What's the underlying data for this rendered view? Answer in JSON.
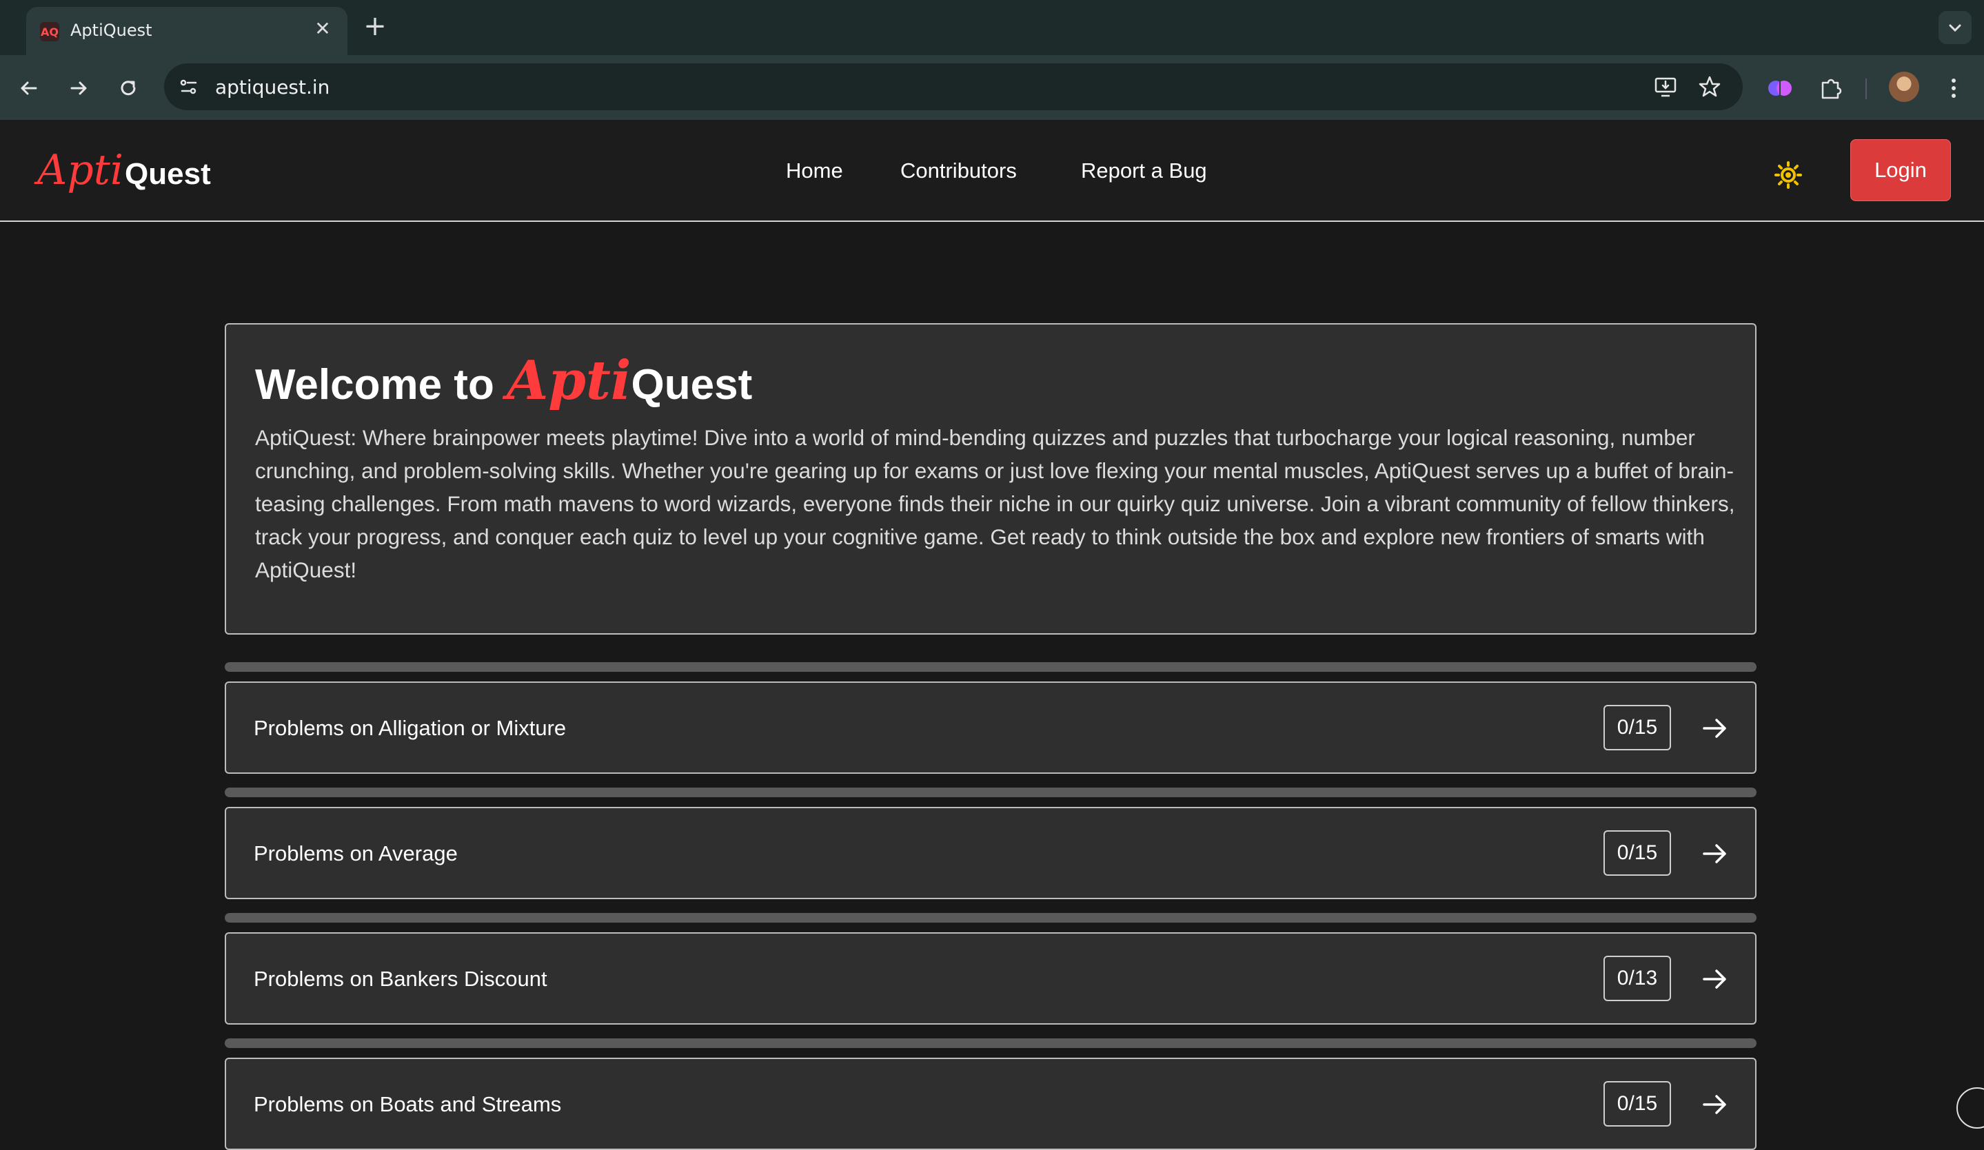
{
  "browser": {
    "tab_title": "AptiQuest",
    "favicon_text": "AQ",
    "url": "aptiquest.in",
    "icons": {
      "back": "back-arrow-icon",
      "forward": "forward-arrow-icon",
      "reload": "reload-icon",
      "site_info": "site-settings-icon",
      "install": "install-app-icon",
      "bookmark": "star-icon",
      "extension_brain": "brain-extension-icon",
      "extensions": "puzzle-icon",
      "menu": "kebab-menu-icon"
    }
  },
  "site": {
    "logo": {
      "apti": "Apti",
      "quest": "Quest"
    },
    "nav": [
      {
        "label": "Home"
      },
      {
        "label": "Contributors"
      },
      {
        "label": "Report a Bug"
      }
    ],
    "login_label": "Login",
    "theme_icon": "sun-icon",
    "accent_color": "#dc3b3b"
  },
  "welcome": {
    "prefix": "Welcome to",
    "apti": "Apti",
    "quest": "Quest",
    "description": "AptiQuest: Where brainpower meets playtime! Dive into a world of mind-bending quizzes and puzzles that turbocharge your logical reasoning, number crunching, and problem-solving skills. Whether you're gearing up for exams or just love flexing your mental muscles, AptiQuest serves up a buffet of brain-teasing challenges. From math mavens to word wizards, everyone finds their niche in our quirky quiz universe. Join a vibrant community of fellow thinkers, track your progress, and conquer each quiz to level up your cognitive game. Get ready to think outside the box and explore new frontiers of smarts with AptiQuest!"
  },
  "topics": [
    {
      "title": "Problems on Alligation or Mixture",
      "count": "0/15",
      "progress": 0
    },
    {
      "title": "Problems on Average",
      "count": "0/15",
      "progress": 0
    },
    {
      "title": "Problems on Bankers Discount",
      "count": "0/13",
      "progress": 0
    },
    {
      "title": "Problems on Boats and Streams",
      "count": "0/15",
      "progress": 0
    }
  ]
}
